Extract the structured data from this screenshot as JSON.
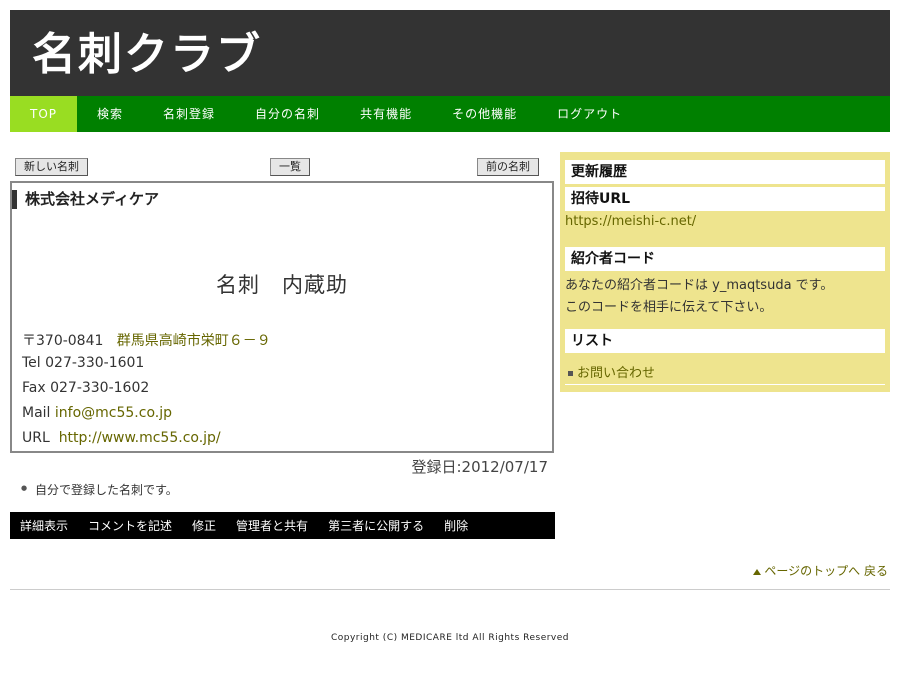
{
  "header": {
    "title": "名刺クラブ"
  },
  "nav": {
    "items": [
      {
        "label": "TOP"
      },
      {
        "label": "検索"
      },
      {
        "label": "名刺登録"
      },
      {
        "label": "自分の名刺"
      },
      {
        "label": "共有機能"
      },
      {
        "label": "その他機能"
      },
      {
        "label": "ログアウト"
      }
    ]
  },
  "toolbar": {
    "new_label": "新しい名刺",
    "list_label": "一覧",
    "prev_label": "前の名刺"
  },
  "card": {
    "company": "株式会社メディケア",
    "name": "名刺　内蔵助",
    "postal": "〒370-0841",
    "address": "群馬県高崎市栄町６－９",
    "tel_label": "Tel",
    "tel": "027-330-1601",
    "fax_label": "Fax",
    "fax": "027-330-1602",
    "mail_label": "Mail",
    "mail": "info@mc55.co.jp",
    "url_label": "URL",
    "url": "http://www.mc55.co.jp/"
  },
  "registration": {
    "date_text": "登録日:2012/07/17"
  },
  "note": "自分で登録した名刺です。",
  "actions": {
    "items": [
      {
        "label": "詳細表示"
      },
      {
        "label": "コメントを記述"
      },
      {
        "label": "修正"
      },
      {
        "label": "管理者と共有"
      },
      {
        "label": "第三者に公開する"
      },
      {
        "label": "削除"
      }
    ]
  },
  "sidebar": {
    "history_title": "更新履歴",
    "invite_title": "招待URL",
    "invite_url": "https://meishi-c.net/",
    "referrer_title": "紹介者コード",
    "referrer_line1": "あなたの紹介者コードは y_maqtsuda です。",
    "referrer_line2": "このコードを相手に伝えて下さい。",
    "list_title": "リスト",
    "list_item": "お問い合わせ"
  },
  "footer": {
    "pagetop": "ページのトップへ 戻る",
    "copyright": "Copyright (C) MEDICARE ltd All Rights Reserved"
  },
  "colors": {
    "header_bg": "#333333",
    "nav_bg": "#008000",
    "nav_active": "#99dd22",
    "sidebar_bg": "#eee48e",
    "link": "#666600"
  }
}
